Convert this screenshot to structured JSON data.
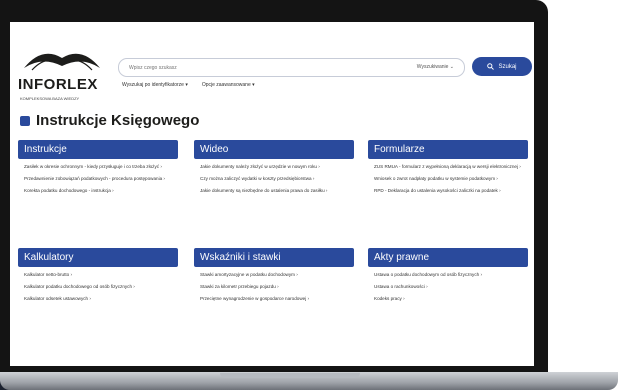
{
  "logo": {
    "name": "INFORLEX",
    "subtitle": "KOMPLEKSOWA BAZA WIEDZY"
  },
  "search": {
    "placeholder": "Wpisz czego szukasz",
    "scope": "Wyszukiwanie ⌄",
    "button_label": "Szukaj"
  },
  "sub_links": [
    "Wyszukaj po identyfikatorze ▾",
    "Opcje zaawansowane ▾"
  ],
  "page_title": "Instrukcje Księgowego",
  "cards": [
    {
      "title": "Instrukcje",
      "items": [
        "Zasiłek w okresie ochronnym - kiedy przysługuje i co trzeba złożyć ›",
        "Przedawnienie zobowiązań podatkowych - procedura postępowania ›",
        "Korekta podatku dochodowego - instrukcja ›"
      ]
    },
    {
      "title": "Wideo",
      "items": [
        "Jakie dokumenty należy złożyć w urzędzie w nowym roku ›",
        "Czy można zaliczyć wydatki w koszty przedsiębiorstwa ›",
        "Jakie dokumenty są niezbędne do ustalenia prawa do zasiłku ›"
      ]
    },
    {
      "title": "Formularze",
      "items": [
        "ZUS RMUA - formularz z wypełnioną deklaracją w wersji elektronicznej ›",
        "Wniosek o zwrot nadpłaty podatku w systemie podatkowym ›",
        "RPD - Deklaracja do ustalenia wysokości zaliczki na podatek ›"
      ]
    },
    {
      "title": "Kalkulatory",
      "items": [
        "Kalkulator netto-brutto ›",
        "Kalkulator podatku dochodowego od osób fizycznych ›",
        "Kalkulator odsetek ustawowych ›"
      ]
    },
    {
      "title": "Wskaźniki i stawki",
      "items": [
        "Stawki amortyzacyjne w podatku dochodowym ›",
        "Stawki za kilometr przebiegu pojazdu ›",
        "Przeciętne wynagrodzenie w gospodarce narodowej ›"
      ]
    },
    {
      "title": "Akty prawne",
      "items": [
        "Ustawa o podatku dochodowym od osób fizycznych ›",
        "Ustawa o rachunkowości ›",
        "Kodeks pracy ›"
      ]
    }
  ]
}
